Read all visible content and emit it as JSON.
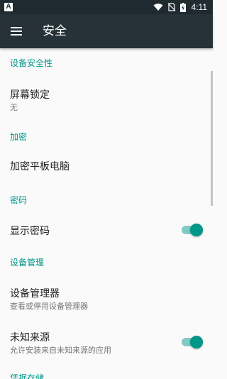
{
  "status_bar": {
    "app_icon_letter": "A",
    "time": "4:11"
  },
  "app_bar": {
    "menu_icon": "hamburger-menu-icon",
    "title": "安全"
  },
  "sections": {
    "device_security": {
      "header": "设备安全性",
      "screen_lock": {
        "title": "屏幕锁定",
        "summary": "无"
      }
    },
    "encryption": {
      "header": "加密",
      "encrypt_tablet": {
        "title": "加密平板电脑"
      }
    },
    "passwords": {
      "header": "密码",
      "show_passwords": {
        "title": "显示密码",
        "enabled": true
      }
    },
    "device_admin": {
      "header": "设备管理",
      "device_administrators": {
        "title": "设备管理器",
        "summary": "查看或停用设备管理器"
      },
      "unknown_sources": {
        "title": "未知来源",
        "summary": "允许安装来自未知来源的应用",
        "enabled": true
      }
    },
    "credential_storage": {
      "header": "凭据存储"
    }
  },
  "colors": {
    "status_bar": "#1f2b30",
    "app_bar": "#263238",
    "accent": "#009688",
    "switch_track": "#80cbc4",
    "background": "#fafafa"
  }
}
